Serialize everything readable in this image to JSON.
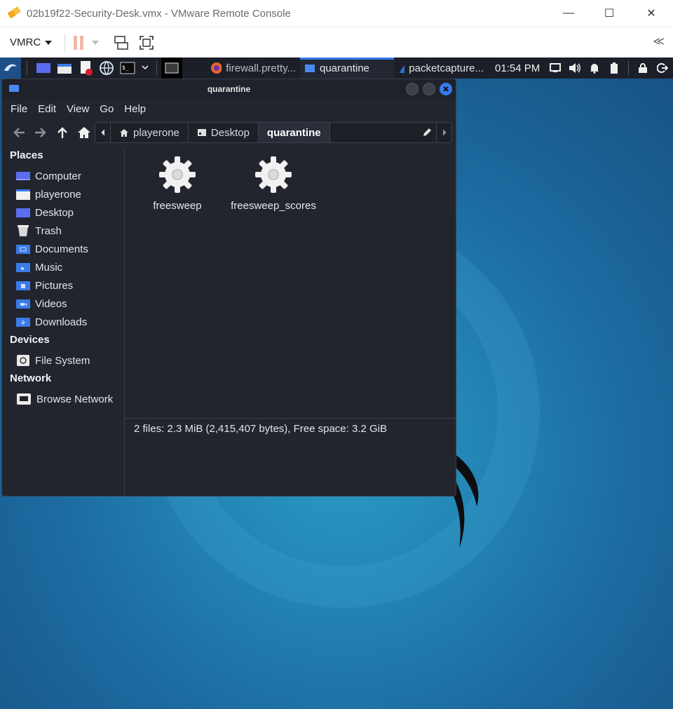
{
  "host_window": {
    "title": "02b19f22-Security-Desk.vmx - VMware Remote Console",
    "minimize_glyph": "—",
    "maximize_glyph": "☐",
    "close_glyph": "✕"
  },
  "vmrc_toolbar": {
    "menu_label": "VMRC",
    "collapse_glyph": "≪"
  },
  "guest_panel": {
    "tasks": [
      {
        "label": "firewall.pretty...",
        "icon": "firefox-icon"
      },
      {
        "label": "quarantine",
        "icon": "folder-icon"
      },
      {
        "label": "packetcapture...",
        "icon": "wireshark-icon"
      }
    ],
    "clock": "01:54 PM"
  },
  "file_manager": {
    "title": "quarantine",
    "menu": [
      "File",
      "Edit",
      "View",
      "Go",
      "Help"
    ],
    "breadcrumbs": [
      {
        "label": "playerone",
        "icon": "home-icon"
      },
      {
        "label": "Desktop",
        "icon": "desktop-icon"
      },
      {
        "label": "quarantine",
        "icon": ""
      }
    ],
    "sidebar": {
      "places_heading": "Places",
      "places": [
        "Computer",
        "playerone",
        "Desktop",
        "Trash",
        "Documents",
        "Music",
        "Pictures",
        "Videos",
        "Downloads"
      ],
      "devices_heading": "Devices",
      "devices": [
        "File System"
      ],
      "network_heading": "Network",
      "network": [
        "Browse Network"
      ]
    },
    "files": [
      {
        "name": "freesweep",
        "icon": "executable-gear-icon"
      },
      {
        "name": "freesweep_scores",
        "icon": "executable-gear-icon"
      }
    ],
    "status": "2 files: 2.3 MiB (2,415,407 bytes), Free space: 3.2 GiB"
  },
  "colors": {
    "accent": "#367bf0",
    "panel_bg": "#1c1f27",
    "window_bg": "#22252e"
  }
}
